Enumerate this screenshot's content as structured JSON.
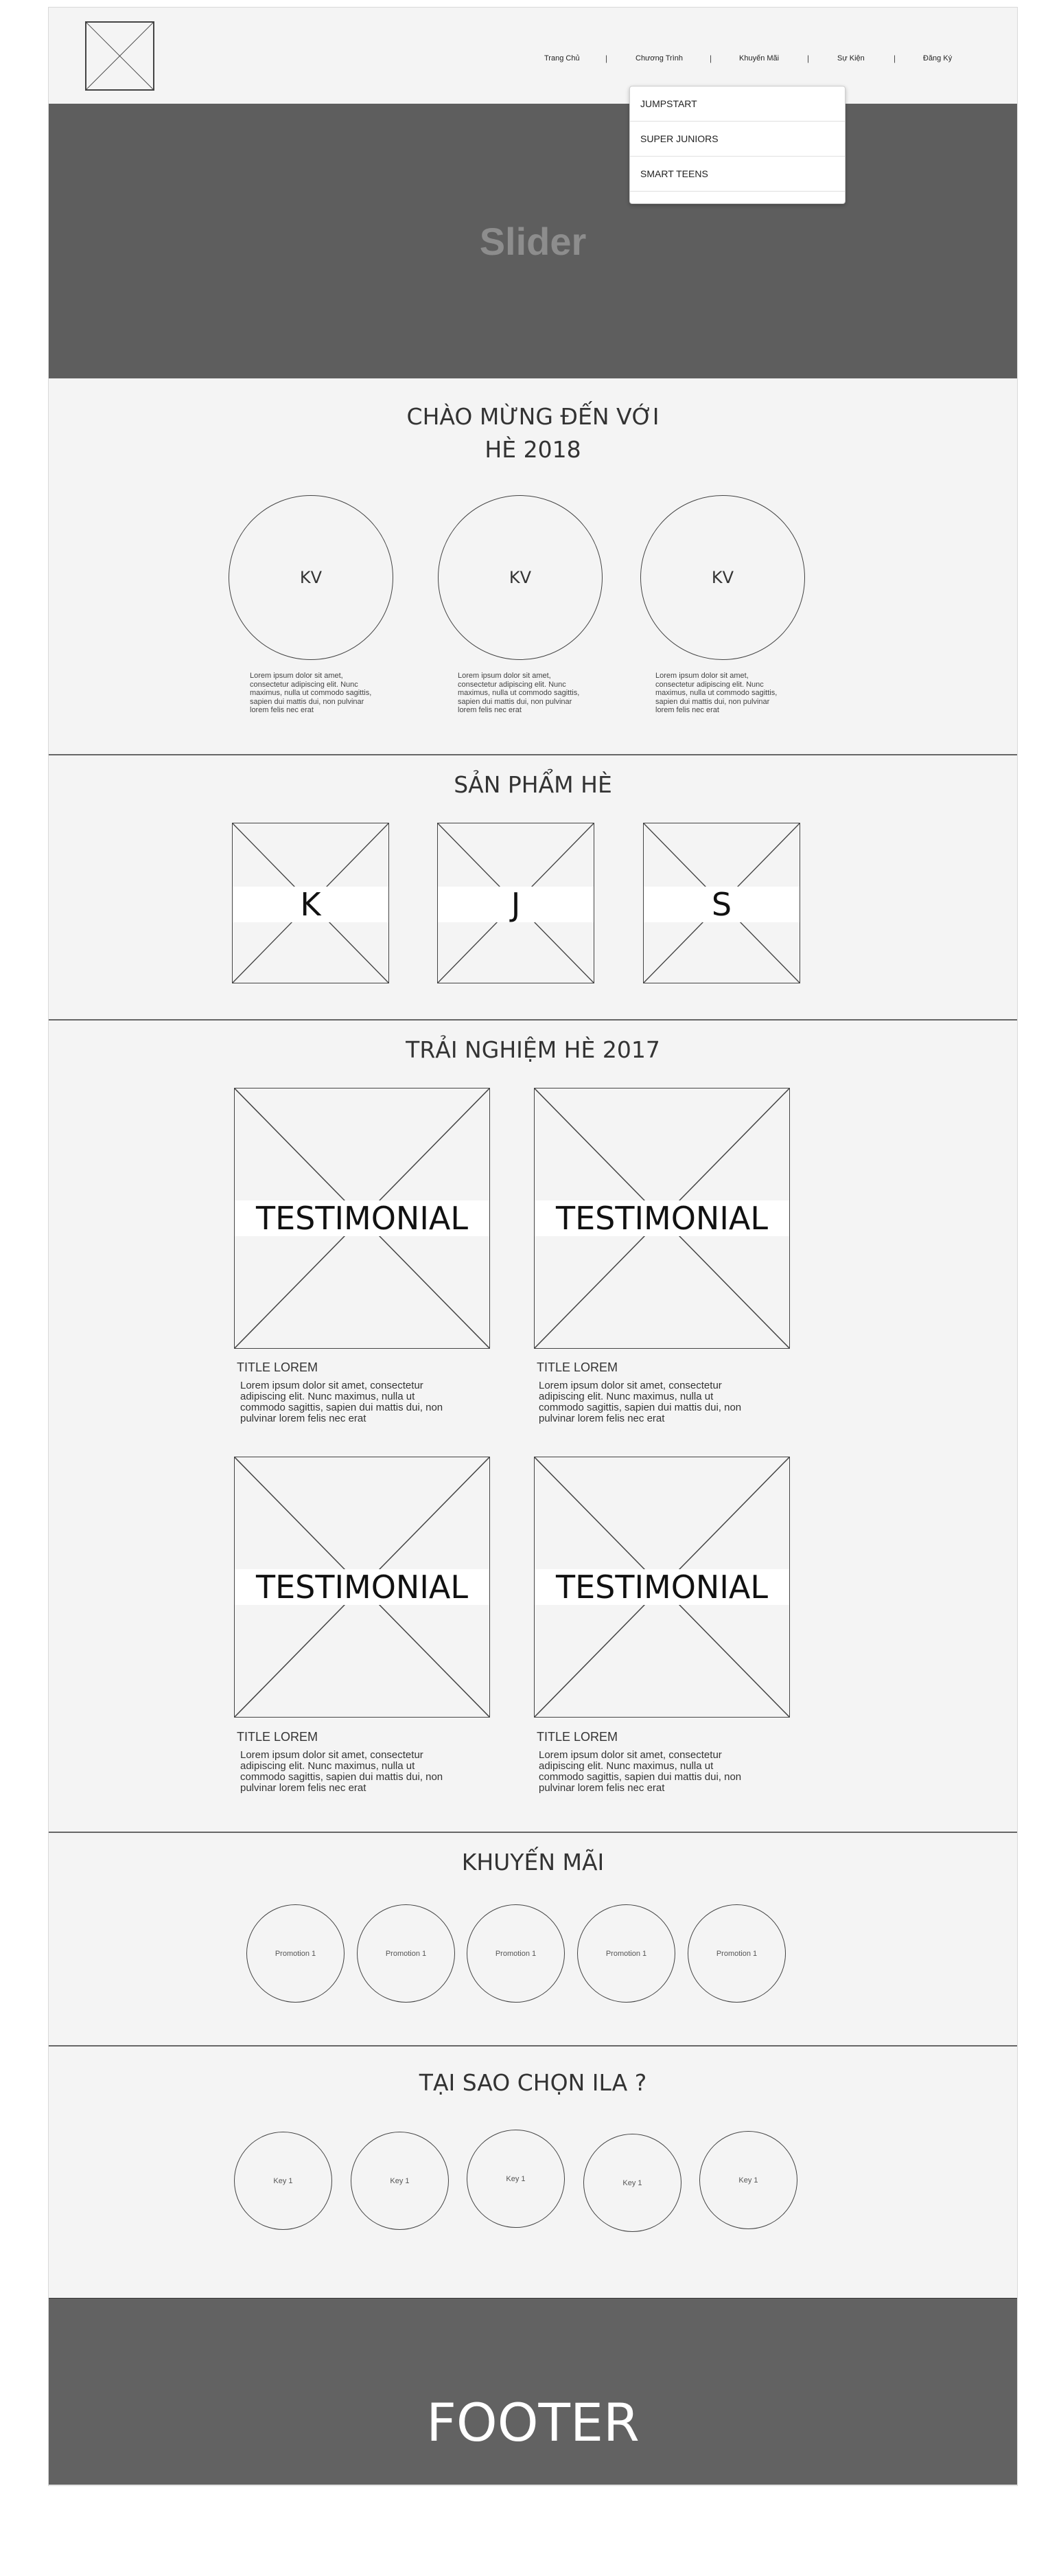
{
  "nav": {
    "items": [
      "Trang Chủ",
      "Chương Trình",
      "Khuyến Mãi",
      "Sự Kiện",
      "Đăng Ký"
    ],
    "separator": "|"
  },
  "dropdown": {
    "items": [
      "JUMPSTART",
      "SUPER JUNIORS",
      "SMART TEENS"
    ]
  },
  "slider": {
    "label": "Slider"
  },
  "welcome": {
    "title_line1": "CHÀO MỪNG ĐẾN VỚI",
    "title_line2": "HÈ 2018",
    "cards": [
      {
        "label": "KV",
        "text": "Lorem ipsum dolor sit amet, consectetur adipiscing elit. Nunc maximus, nulla ut commodo sagittis, sapien dui mattis dui, non pulvinar lorem felis nec erat"
      },
      {
        "label": "KV",
        "text": "Lorem ipsum dolor sit amet, consectetur adipiscing elit. Nunc maximus, nulla ut commodo sagittis, sapien dui mattis dui, non pulvinar lorem felis nec erat"
      },
      {
        "label": "KV",
        "text": "Lorem ipsum dolor sit amet, consectetur adipiscing elit. Nunc maximus, nulla ut commodo sagittis, sapien dui mattis dui, non pulvinar lorem felis nec erat"
      }
    ]
  },
  "products": {
    "title": "SẢN PHẨM HÈ",
    "items": [
      "K",
      "J",
      "S"
    ]
  },
  "testimonials": {
    "title": "TRẢI NGHIỆM HÈ 2017",
    "items": [
      {
        "label": "TESTIMONIAL",
        "title": "TITLE LOREM",
        "text": "Lorem ipsum dolor sit amet, consectetur adipiscing elit. Nunc maximus, nulla ut commodo sagittis, sapien dui mattis dui, non pulvinar lorem felis nec erat"
      },
      {
        "label": "TESTIMONIAL",
        "title": "TITLE LOREM",
        "text": "Lorem ipsum dolor sit amet, consectetur adipiscing elit. Nunc maximus, nulla ut commodo sagittis, sapien dui mattis dui, non pulvinar lorem felis nec erat"
      },
      {
        "label": "TESTIMONIAL",
        "title": "TITLE LOREM",
        "text": "Lorem ipsum dolor sit amet, consectetur adipiscing elit. Nunc maximus, nulla ut commodo sagittis, sapien dui mattis dui, non pulvinar lorem felis nec erat"
      },
      {
        "label": "TESTIMONIAL",
        "title": "TITLE LOREM",
        "text": "Lorem ipsum dolor sit amet, consectetur adipiscing elit. Nunc maximus, nulla ut commodo sagittis, sapien dui mattis dui, non pulvinar lorem felis nec erat"
      }
    ]
  },
  "promotions": {
    "title": "KHUYẾN MÃI",
    "items": [
      "Promotion 1",
      "Promotion 1",
      "Promotion 1",
      "Promotion 1",
      "Promotion 1"
    ]
  },
  "why": {
    "title": "TẠI SAO CHỌN ILA ?",
    "items": [
      "Key 1",
      "Key 1",
      "Key 1",
      "Key 1",
      "Key 1"
    ]
  },
  "footer": {
    "label": "FOOTER"
  },
  "colors": {
    "dark_block": "#5e5e5e",
    "footer": "#626262",
    "page_bg": "#f4f4f4"
  }
}
